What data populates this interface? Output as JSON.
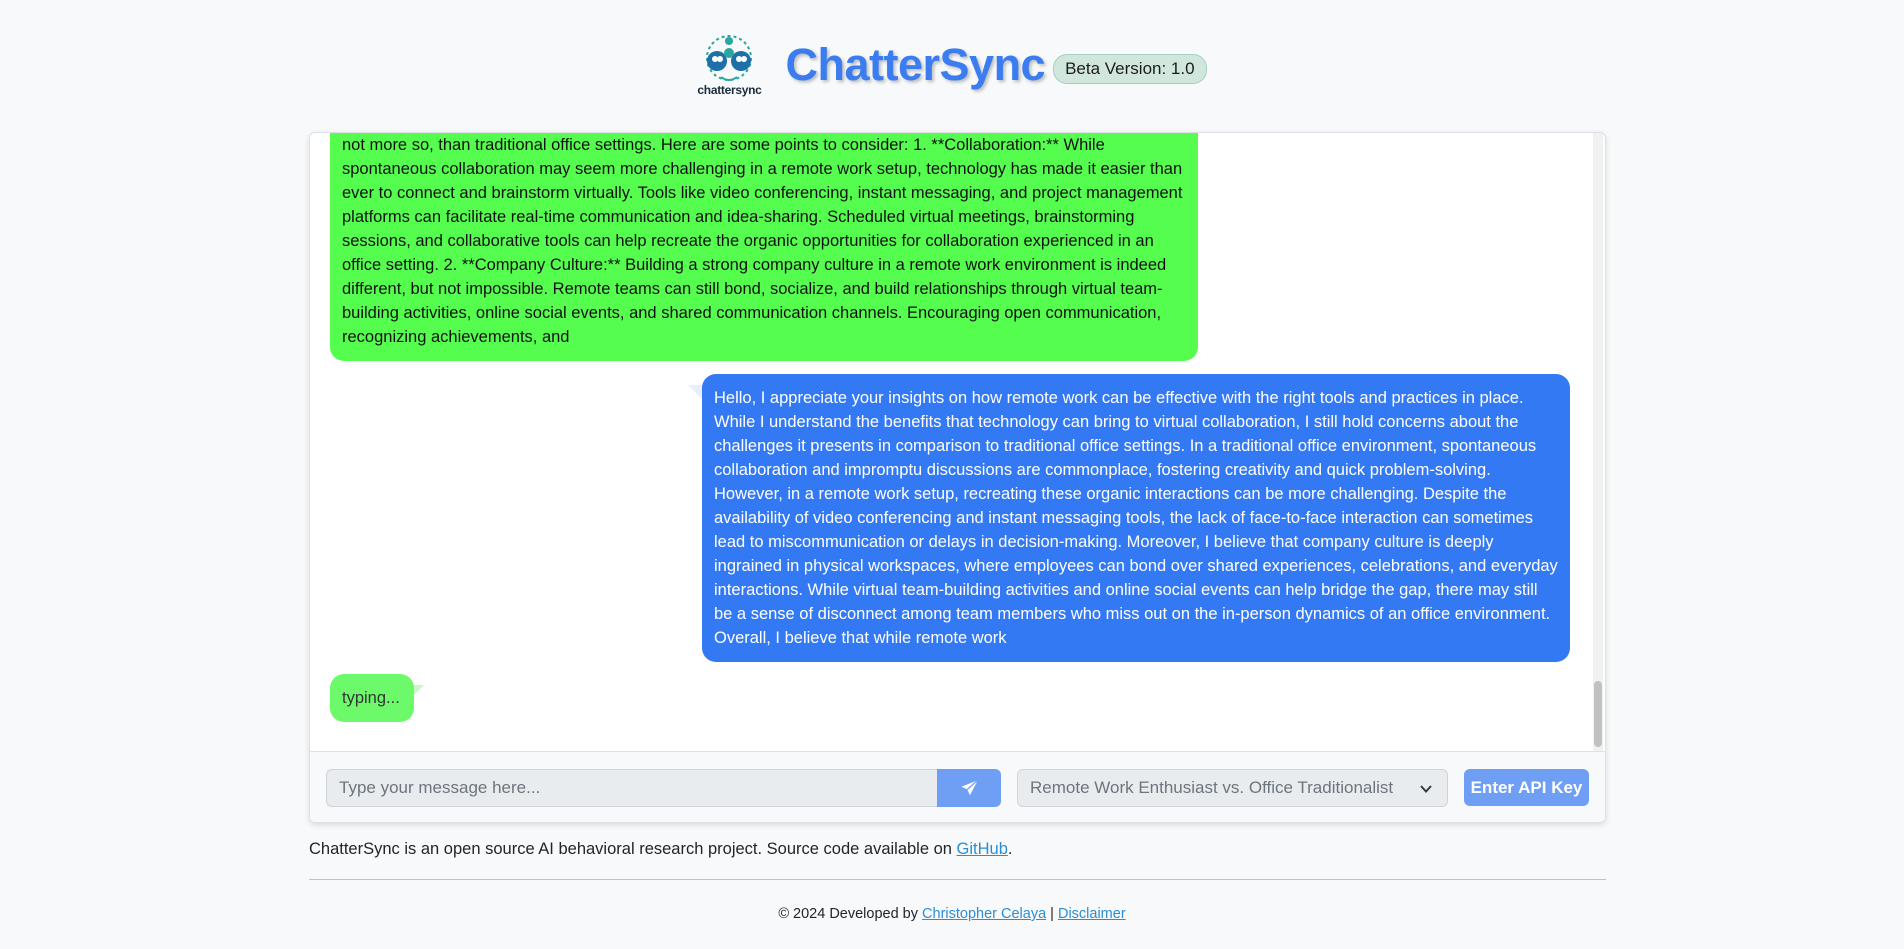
{
  "header": {
    "logo_text": "chattersync",
    "title": "ChatterSync",
    "badge": "Beta Version: 1.0"
  },
  "chat": {
    "messages": [
      {
        "side": "left",
        "text": "not more so, than traditional office settings. Here are some points to consider: 1. **Collaboration:** While spontaneous collaboration may seem more challenging in a remote work setup, technology has made it easier than ever to connect and brainstorm virtually. Tools like video conferencing, instant messaging, and project management platforms can facilitate real-time communication and idea-sharing. Scheduled virtual meetings, brainstorming sessions, and collaborative tools can help recreate the organic opportunities for collaboration experienced in an office setting. 2. **Company Culture:** Building a strong company culture in a remote work environment is indeed different, but not impossible. Remote teams can still bond, socialize, and build relationships through virtual team-building activities, online social events, and shared communication channels. Encouraging open communication, recognizing achievements, and"
      },
      {
        "side": "right",
        "text": "Hello, I appreciate your insights on how remote work can be effective with the right tools and practices in place. While I understand the benefits that technology can bring to virtual collaboration, I still hold concerns about the challenges it presents in comparison to traditional office settings. In a traditional office environment, spontaneous collaboration and impromptu discussions are commonplace, fostering creativity and quick problem-solving. However, in a remote work setup, recreating these organic interactions can be more challenging. Despite the availability of video conferencing and instant messaging tools, the lack of face-to-face interaction can sometimes lead to miscommunication or delays in decision-making. Moreover, I believe that company culture is deeply ingrained in physical workspaces, where employees can bond over shared experiences, celebrations, and everyday interactions. While virtual team-building activities and online social events can help bridge the gap, there may still be a sense of disconnect among team members who miss out on the in-person dynamics of an office environment. Overall, I believe that while remote work"
      }
    ],
    "typing": "typing..."
  },
  "input": {
    "placeholder": "Type your message here...",
    "send_icon": "paper-plane-icon",
    "persona_selected": "Remote Work Enthusiast vs. Office Traditionalist",
    "api_button": "Enter API Key"
  },
  "footer": {
    "note_prefix": "ChatterSync is an open source AI behavioral research project. Source code available on ",
    "note_link": "GitHub",
    "note_suffix": ".",
    "copyright_prefix": "© 2024 Developed by ",
    "author_link": "Christopher Celaya",
    "separator": " | ",
    "disclaimer_link": "Disclaimer"
  },
  "colors": {
    "brand": "#3b7df0",
    "bot_bubble": "#55fd4e",
    "user_bubble": "#3379f4",
    "button": "#6f9ff5"
  }
}
